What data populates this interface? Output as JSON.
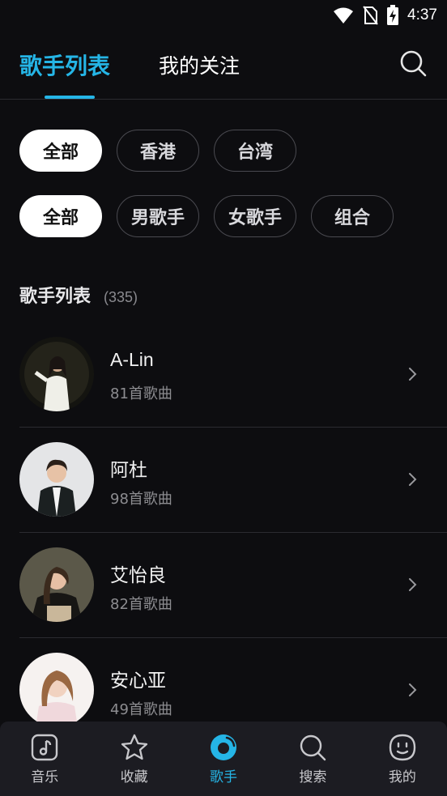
{
  "status": {
    "time": "4:37"
  },
  "header": {
    "tabs": [
      {
        "label": "歌手列表",
        "active": true
      },
      {
        "label": "我的关注",
        "active": false
      }
    ]
  },
  "filters": {
    "region": [
      "全部",
      "香港",
      "台湾"
    ],
    "type": [
      "全部",
      "男歌手",
      "女歌手",
      "组合"
    ],
    "selected_region": "全部",
    "selected_type": "全部"
  },
  "section": {
    "title": "歌手列表",
    "count": "(335)"
  },
  "artists": [
    {
      "name": "A-Lin",
      "songs": "81首歌曲"
    },
    {
      "name": "阿杜",
      "songs": "98首歌曲"
    },
    {
      "name": "艾怡良",
      "songs": "82首歌曲"
    },
    {
      "name": "安心亚",
      "songs": "49首歌曲"
    }
  ],
  "nav": [
    {
      "label": "音乐",
      "icon": "music-note-icon",
      "active": false
    },
    {
      "label": "收藏",
      "icon": "star-icon",
      "active": false
    },
    {
      "label": "歌手",
      "icon": "singer-icon",
      "active": true
    },
    {
      "label": "搜索",
      "icon": "search-icon",
      "active": false
    },
    {
      "label": "我的",
      "icon": "smiley-icon",
      "active": false
    }
  ],
  "colors": {
    "accent": "#25b5e6",
    "background": "#0d0d10",
    "nav_bg": "#1c1c22"
  }
}
